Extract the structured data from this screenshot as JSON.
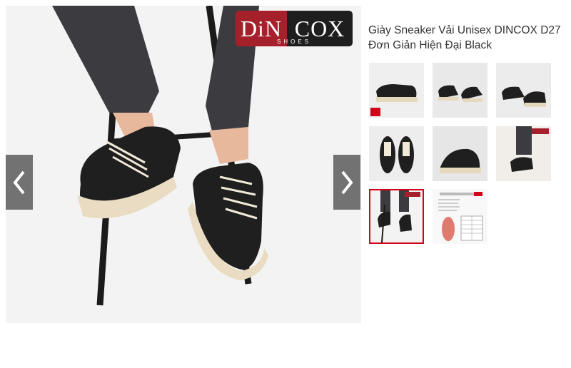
{
  "brand": {
    "logo_left": "DiN",
    "logo_right": "COX",
    "logo_sub": "SHOES"
  },
  "product": {
    "title": "Giày Sneaker Vải Unisex DINCOX D27 Đơn Giản Hiện Đại Black"
  },
  "gallery": {
    "prev_icon": "chevron-left-icon",
    "next_icon": "chevron-right-icon",
    "active_index": 6,
    "thumb_count": 8
  },
  "colors": {
    "accent": "#d0021b",
    "logo_red": "#a5202b",
    "logo_dark": "#1e1e1e",
    "nav_bg": "#5a5a5a"
  }
}
